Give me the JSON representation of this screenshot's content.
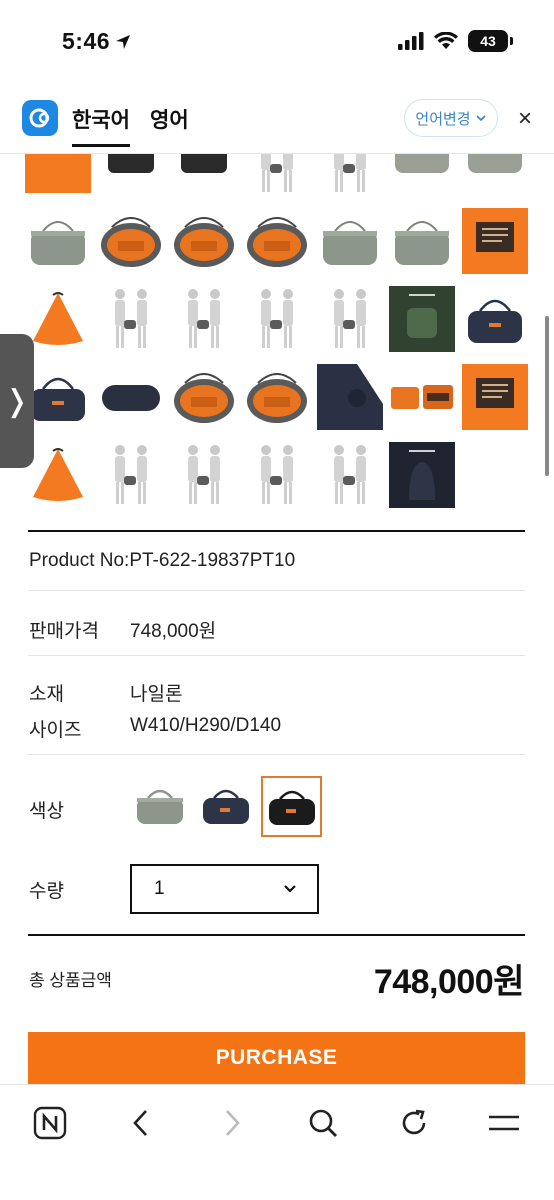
{
  "status": {
    "time": "5:46",
    "battery": "43"
  },
  "translate": {
    "tab_active": "한국어",
    "tab_other": "영어",
    "lang_button": "언어변경",
    "close": "×"
  },
  "thumbnail_rows": [
    [
      "orange",
      "black",
      "black",
      "figure",
      "figure",
      "gray",
      "gray"
    ],
    [
      "graybag",
      "orange-inner",
      "orange-inner",
      "orange-inner",
      "graybag",
      "graybag",
      "orange-card"
    ],
    [
      "orange-pouch",
      "figure",
      "figure",
      "figure",
      "figure",
      "green-poster",
      "navy-bag"
    ],
    [
      "navy-bag",
      "navy-pouch",
      "orange-inner",
      "orange-inner",
      "navy-closeup",
      "orange-wallet",
      "orange-card"
    ],
    [
      "orange-pouch",
      "figure",
      "figure",
      "figure",
      "figure",
      "dark-poster"
    ]
  ],
  "product": {
    "product_no": "Product No:PT-622-19837PT10",
    "price_label": "판매가격",
    "price_value": "748,000원",
    "material_label": "소재",
    "material_value": "나일론",
    "size_label": "사이즈",
    "size_value": "W410/H290/D140",
    "color_label": "색상",
    "colors": [
      "#8d968a",
      "#2d3447",
      "#1b1b1b"
    ],
    "quantity_label": "수량",
    "quantity_value": "1",
    "total_label": "총 상품금액",
    "total_value": "748,000원",
    "purchase_label": "PURCHASE"
  },
  "accent_color": "#f47415"
}
